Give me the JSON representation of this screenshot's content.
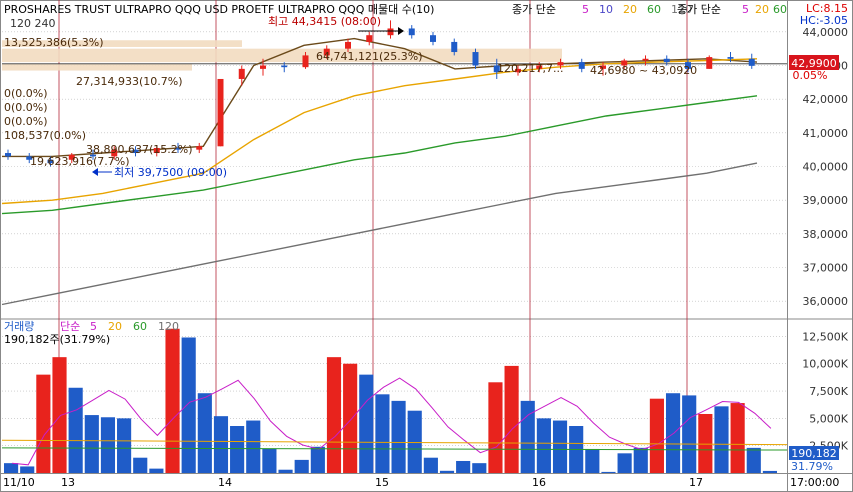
{
  "header": {
    "title": "PROSHARES TRUST ULTRAPRO QQQ USD  PROETF ULTRAPRO QQQ 매물대 수(10)",
    "sub_left": "120  240",
    "ma_legend_label": "종가 단순",
    "ma_legend_periods": [
      "5",
      "10",
      "20",
      "60",
      "120"
    ],
    "ma_legend2_label": "종가 단순",
    "ma_legend2_periods": [
      "5",
      "20",
      "60"
    ],
    "lc": "LC:8.15",
    "hc": "HC:-3.05"
  },
  "volume_profile_labels": [
    "13,525,386(5.3%)",
    "27,314,933(10.7%)",
    "0(0.0%)",
    "0(0.0%)",
    "0(0.0%)",
    "108,537(0.0%)",
    "38,890,637(15.2%)",
    "19,623,916(7.7%)",
    "64,741,121(25.3%)",
    "120,217,7...",
    "42,6980 ~ 43,0920"
  ],
  "annotations": {
    "high": "최고 44,3415 (08:00)",
    "low": "최저 39,7500 (09:00)"
  },
  "price_tag": {
    "value": "42,9900",
    "pct": "0.05%"
  },
  "volume_header": {
    "label": "거래량",
    "ma_label": "단순",
    "periods": [
      "5",
      "20",
      "60",
      "120"
    ],
    "current": "190,182주(31.79%)"
  },
  "volume_tag": {
    "value": "190,182",
    "pct": "31.79%"
  },
  "colors": {
    "up": "#e8231d",
    "down": "#1f5cc8",
    "ma5": "#c81ec8",
    "ma20": "#e8a400",
    "ma60": "#2a9a2a",
    "ma120": "#707070",
    "ma_dark": "#6b4a1a",
    "ma10": "#4a46c8",
    "grid": "#b8b8b8",
    "separator": "#b4283a",
    "profile": "#f2dcc0"
  },
  "chart_data": [
    {
      "type": "line",
      "title": "PROSHARES TRUST ULTRAPRO QQQ USD",
      "x": [
        "11/10",
        "13",
        "14",
        "15",
        "16",
        "17"
      ],
      "ylim": [
        35.5,
        44.5
      ],
      "y_ticks": [
        "36,0000",
        "37,0000",
        "38,0000",
        "39,0000",
        "40,0000",
        "41,0000",
        "42,0000",
        "43,0000",
        "44,0000"
      ],
      "price_ohlc_sampled": [
        [
          40.4,
          40.5,
          40.2,
          40.3
        ],
        [
          40.3,
          40.4,
          40.1,
          40.2
        ],
        [
          40.2,
          40.3,
          40.0,
          40.1
        ],
        [
          40.2,
          40.4,
          40.1,
          40.35
        ],
        [
          40.35,
          40.5,
          40.2,
          40.3
        ],
        [
          40.3,
          40.6,
          40.2,
          40.5
        ],
        [
          40.5,
          40.6,
          40.3,
          40.4
        ],
        [
          40.4,
          40.6,
          40.3,
          40.55
        ],
        [
          40.55,
          40.7,
          40.4,
          40.5
        ],
        [
          40.5,
          40.7,
          40.4,
          40.6
        ],
        [
          40.6,
          42.5,
          40.6,
          42.6
        ],
        [
          42.6,
          43.0,
          42.4,
          42.9
        ],
        [
          42.9,
          43.2,
          42.7,
          43.0
        ],
        [
          43.0,
          43.1,
          42.8,
          42.95
        ],
        [
          42.95,
          43.4,
          42.9,
          43.3
        ],
        [
          43.3,
          43.6,
          43.2,
          43.5
        ],
        [
          43.5,
          43.8,
          43.4,
          43.7
        ],
        [
          43.7,
          44.0,
          43.6,
          43.9
        ],
        [
          43.9,
          44.34,
          43.8,
          44.1
        ],
        [
          44.1,
          44.2,
          43.8,
          43.9
        ],
        [
          43.9,
          44.0,
          43.6,
          43.7
        ],
        [
          43.7,
          43.8,
          43.3,
          43.4
        ],
        [
          43.4,
          43.5,
          42.9,
          43.0
        ],
        [
          43.0,
          43.2,
          42.6,
          42.8
        ],
        [
          42.8,
          43.0,
          42.7,
          42.9
        ],
        [
          42.9,
          43.1,
          42.8,
          43.0
        ],
        [
          43.0,
          43.2,
          42.9,
          43.1
        ],
        [
          43.1,
          43.2,
          42.8,
          42.9
        ],
        [
          42.9,
          43.1,
          42.7,
          43.0
        ],
        [
          43.0,
          43.2,
          42.9,
          43.15
        ],
        [
          43.15,
          43.3,
          43.0,
          43.2
        ],
        [
          43.2,
          43.3,
          43.0,
          43.1
        ],
        [
          43.1,
          43.2,
          42.8,
          42.9
        ],
        [
          42.9,
          43.3,
          42.9,
          43.25
        ],
        [
          43.25,
          43.4,
          43.1,
          43.2
        ],
        [
          43.2,
          43.35,
          42.9,
          42.99
        ]
      ],
      "series": [
        {
          "name": "5",
          "values": [
            40.3,
            40.3,
            40.4,
            40.5,
            40.6,
            43.0,
            43.6,
            43.8,
            43.5,
            42.9,
            43.0,
            43.05,
            43.1,
            43.15,
            43.2,
            43.1
          ]
        },
        {
          "name": "20",
          "values": [
            38.9,
            39.0,
            39.2,
            39.5,
            39.8,
            40.8,
            41.6,
            42.1,
            42.4,
            42.6,
            42.8,
            42.95,
            43.05,
            43.1,
            43.15,
            43.2
          ]
        },
        {
          "name": "60",
          "values": [
            38.6,
            38.7,
            38.9,
            39.1,
            39.3,
            39.6,
            39.9,
            40.2,
            40.4,
            40.7,
            40.9,
            41.2,
            41.5,
            41.7,
            41.9,
            42.1
          ]
        },
        {
          "name": "120",
          "values": [
            35.9,
            36.2,
            36.5,
            36.8,
            37.1,
            37.4,
            37.7,
            38.0,
            38.3,
            38.6,
            38.9,
            39.2,
            39.4,
            39.6,
            39.8,
            40.1
          ]
        }
      ],
      "high": 44.3415,
      "low": 39.75,
      "last": 42.99
    },
    {
      "type": "bar",
      "title": "거래량",
      "ylim": [
        0,
        14000
      ],
      "y_ticks": [
        "2,500K",
        "5,000K",
        "7,500K",
        "10,000K",
        "12,500K"
      ],
      "values": [
        900,
        600,
        9000,
        10600,
        7800,
        5300,
        5100,
        5000,
        1400,
        400,
        13200,
        12400,
        7300,
        5200,
        4300,
        4800,
        2200,
        300,
        1200,
        2400,
        10600,
        10000,
        9000,
        7200,
        6600,
        5700,
        1400,
        200,
        1100,
        900,
        8300,
        9800,
        6600,
        5000,
        4800,
        4300,
        2200,
        100,
        1800,
        2300,
        6800,
        7300,
        7100,
        5400,
        6100,
        6400,
        2300,
        190
      ],
      "up": [
        false,
        false,
        true,
        true,
        false,
        false,
        false,
        false,
        false,
        false,
        true,
        false,
        false,
        false,
        false,
        false,
        false,
        false,
        false,
        false,
        true,
        true,
        false,
        false,
        false,
        false,
        false,
        false,
        false,
        false,
        true,
        true,
        false,
        false,
        false,
        false,
        false,
        false,
        false,
        false,
        true,
        false,
        false,
        true,
        false,
        true,
        false,
        false
      ]
    }
  ],
  "x_axis": {
    "labels": [
      "11/10",
      "13",
      "14",
      "15",
      "16",
      "17",
      "17:00:00"
    ]
  }
}
